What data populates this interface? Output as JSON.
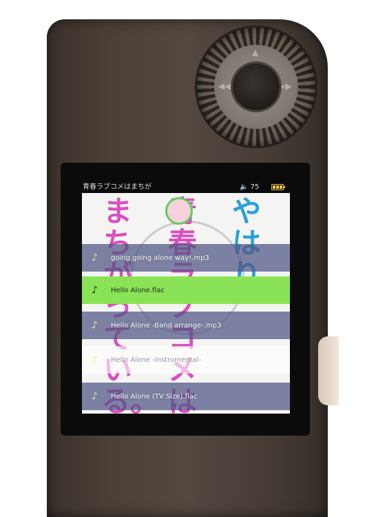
{
  "status_bar": {
    "title": "青春ラブコメはまちが",
    "volume_icon": "speaker-icon",
    "volume_level": "75",
    "battery_icon": "battery-icon",
    "battery_level_fraction": 1.0
  },
  "album_art": {
    "column_right": "やはり",
    "column_middle": "青春ラブコメは",
    "column_left": "まちがっている。"
  },
  "playlist": {
    "note_icon": "♪",
    "tracks": [
      {
        "name": "going going alone way!.mp3",
        "selected": false
      },
      {
        "name": "Hello Alone.flac",
        "selected": true
      },
      {
        "name": "Hello Alone -Band arrange-.mp3",
        "selected": false
      },
      {
        "name": "Hello Alone -Instrumental-",
        "selected": false
      },
      {
        "name": "Hello Alone (TV Size).flac",
        "selected": false
      }
    ]
  },
  "colors": {
    "selected_row": "#8ae356",
    "row_overlay": "#4e5484",
    "battery": "#e7c34a"
  }
}
